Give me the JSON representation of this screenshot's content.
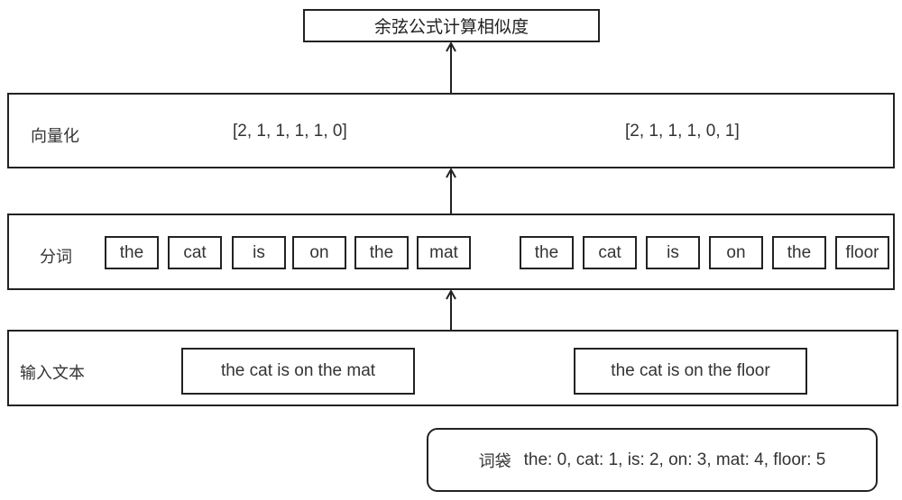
{
  "top": {
    "label": "余弦公式计算相似度"
  },
  "vectorize": {
    "label": "向量化",
    "vectors": [
      "[2, 1, 1, 1, 1, 0]",
      "[2, 1, 1, 1, 0, 1]"
    ]
  },
  "tokenize": {
    "label": "分词",
    "sentence1_tokens": [
      "the",
      "cat",
      "is",
      "on",
      "the",
      "mat"
    ],
    "sentence2_tokens": [
      "the",
      "cat",
      "is",
      "on",
      "the",
      "floor"
    ]
  },
  "input": {
    "label": "输入文本",
    "sentences": [
      "the cat is on the mat",
      "the cat is on the floor"
    ]
  },
  "bag_of_words": {
    "label": "词袋",
    "content": "the: 0, cat: 1, is: 2, on: 3, mat: 4, floor: 5"
  }
}
